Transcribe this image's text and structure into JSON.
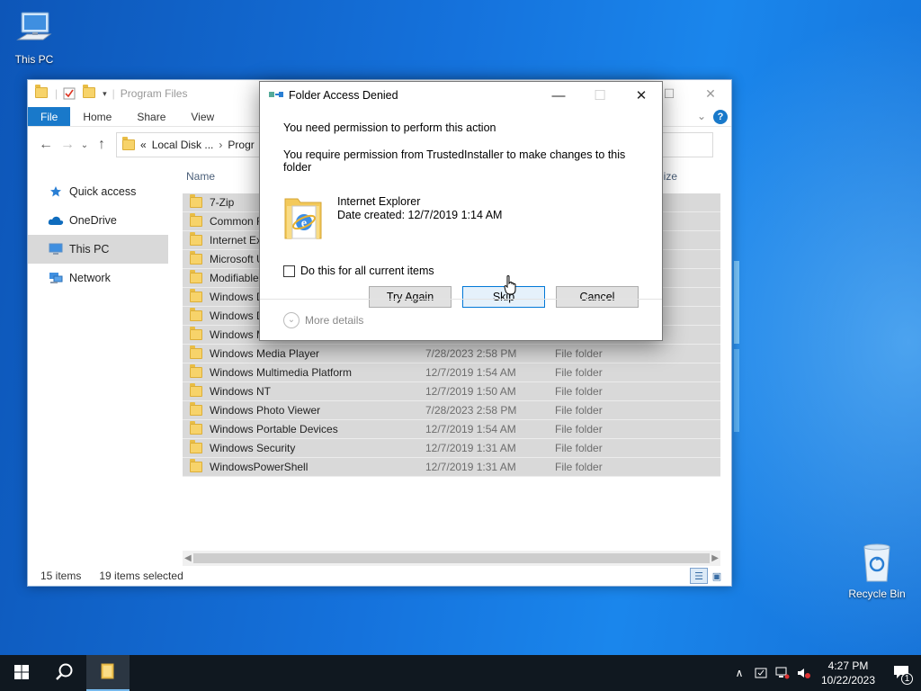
{
  "desktop": {
    "icons": [
      {
        "label": "This PC",
        "icon": "computer-icon"
      },
      {
        "label": "Recycle Bin",
        "icon": "recycle-bin-icon"
      }
    ]
  },
  "explorer": {
    "title": "Program Files",
    "ribbon_tabs": [
      "File",
      "Home",
      "Share",
      "View"
    ],
    "address": {
      "prefix": "«",
      "crumbs": [
        "Local Disk ...",
        "Progr"
      ]
    },
    "nav_items": [
      {
        "label": "Quick access",
        "icon": "star-icon"
      },
      {
        "label": "OneDrive",
        "icon": "cloud-icon"
      },
      {
        "label": "This PC",
        "icon": "computer-icon",
        "selected": true
      },
      {
        "label": "Network",
        "icon": "network-icon"
      }
    ],
    "columns": {
      "name": "Name",
      "size": "Size"
    },
    "rows": [
      {
        "name": "7-Zip",
        "date": "",
        "type": ""
      },
      {
        "name": "Common F",
        "date": "",
        "type": ""
      },
      {
        "name": "Internet Exp",
        "date": "",
        "type": ""
      },
      {
        "name": "Microsoft U",
        "date": "",
        "type": ""
      },
      {
        "name": "ModifiableW",
        "date": "",
        "type": ""
      },
      {
        "name": "Windows D",
        "date": "",
        "type": ""
      },
      {
        "name": "Windows D",
        "date": "",
        "type": ""
      },
      {
        "name": "Windows M",
        "date": "",
        "type": ""
      },
      {
        "name": "Windows Media Player",
        "date": "7/28/2023 2:58 PM",
        "type": "File folder"
      },
      {
        "name": "Windows Multimedia Platform",
        "date": "12/7/2019 1:54 AM",
        "type": "File folder"
      },
      {
        "name": "Windows NT",
        "date": "12/7/2019 1:50 AM",
        "type": "File folder"
      },
      {
        "name": "Windows Photo Viewer",
        "date": "7/28/2023 2:58 PM",
        "type": "File folder"
      },
      {
        "name": "Windows Portable Devices",
        "date": "12/7/2019 1:54 AM",
        "type": "File folder"
      },
      {
        "name": "Windows Security",
        "date": "12/7/2019 1:31 AM",
        "type": "File folder"
      },
      {
        "name": "WindowsPowerShell",
        "date": "12/7/2019 1:31 AM",
        "type": "File folder"
      }
    ],
    "status": {
      "count": "15 items",
      "selected": "19 items selected"
    }
  },
  "dialog": {
    "title": "Folder Access Denied",
    "line1": "You need permission to perform this action",
    "line2": "You require permission from TrustedInstaller to make changes to this folder",
    "item_name": "Internet Explorer",
    "item_date": "Date created: 12/7/2019 1:14 AM",
    "checkbox_label": "Do this for all current items",
    "checkbox_checked": false,
    "buttons": {
      "try_again": "Try Again",
      "skip": "Skip",
      "cancel": "Cancel"
    },
    "more_details": "More details"
  },
  "taskbar": {
    "time": "4:27 PM",
    "date": "10/22/2023",
    "notification_count": "1"
  }
}
